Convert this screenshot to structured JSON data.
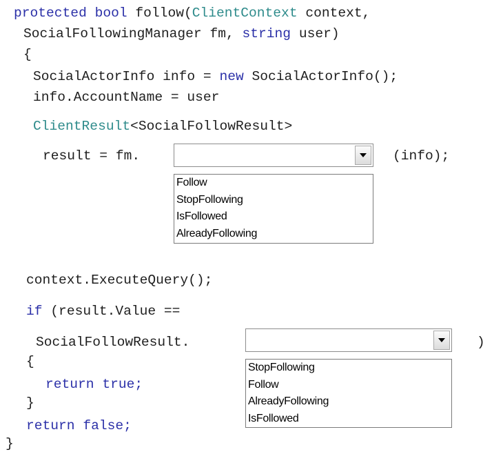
{
  "code": {
    "line1": {
      "kw1": "protected",
      "kw2": "bool",
      "t1": "follow(",
      "ty1": "ClientContext",
      "t2": "context,"
    },
    "line2": {
      "t1": "SocialFollowingManager fm, ",
      "kw1": "string",
      "t2": "user)"
    },
    "line3": "{",
    "line4": {
      "t1": "SocialActorInfo info = ",
      "kw1": "new",
      "t2": "SocialActorInfo();"
    },
    "line5": "info.AccountName = user",
    "line6": {
      "ty1": "ClientResult",
      "t1": "<SocialFollowResult>"
    },
    "line7_prefix": "result = fm.",
    "line7_suffix": "(info);",
    "line8": "context.ExecuteQuery();",
    "line9": {
      "kw1": "if",
      "t1": "(result.Value =="
    },
    "line10_prefix": "SocialFollowResult.",
    "line10_suffix": ")",
    "line11": "{",
    "line12": {
      "kw1": "return",
      "kw2": "true;"
    },
    "line13": "}",
    "line14": {
      "kw1": "return",
      "kw2": "false;"
    },
    "line15": "}"
  },
  "dropdown1": {
    "selected": "",
    "options": [
      "Follow",
      "StopFollowing",
      "IsFollowed",
      "AlreadyFollowing"
    ]
  },
  "dropdown2": {
    "selected": "",
    "options": [
      "StopFollowing",
      "Follow",
      "AlreadyFollowing",
      "IsFollowed"
    ]
  },
  "colors": {
    "keyword": "#2b30a8",
    "type": "#2e8b8b",
    "text": "#1e1e1e"
  },
  "icons": {
    "dropdown_arrow": "chevron-down-icon"
  }
}
